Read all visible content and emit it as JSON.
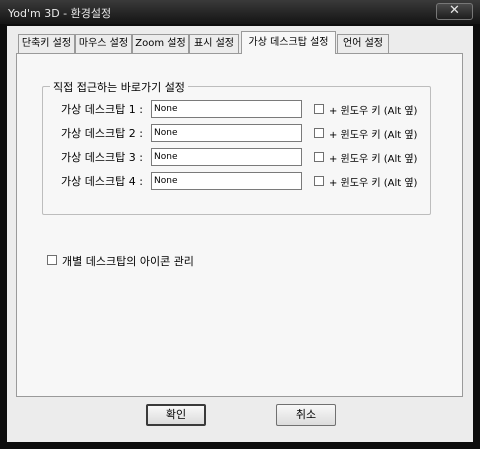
{
  "window": {
    "title": "Yod'm 3D - 환경설정",
    "close_glyph": "✕"
  },
  "tabs": [
    {
      "label": "단축키 설정"
    },
    {
      "label": "마우스 설정"
    },
    {
      "label": "Zoom 설정"
    },
    {
      "label": "표시 설정"
    },
    {
      "label": "가상 데스크탑 설정",
      "active": true
    },
    {
      "label": "언어 설정"
    }
  ],
  "group": {
    "title": "직접 접근하는 바로가기 설정",
    "rows": [
      {
        "label": "가상 데스크탑 1 :",
        "value": "None",
        "check_label": "+ 윈도우 키 (Alt 옆)",
        "checked": false
      },
      {
        "label": "가상 데스크탑 2 :",
        "value": "None",
        "check_label": "+ 윈도우 키 (Alt 옆)",
        "checked": false
      },
      {
        "label": "가상 데스크탑 3 :",
        "value": "None",
        "check_label": "+ 윈도우 키 (Alt 옆)",
        "checked": false
      },
      {
        "label": "가상 데스크탑 4 :",
        "value": "None",
        "check_label": "+ 윈도우 키 (Alt 옆)",
        "checked": false
      }
    ]
  },
  "icon_manage": {
    "label": "개별 데스크탑의 아이콘 관리",
    "checked": false
  },
  "buttons": {
    "ok": "확인",
    "cancel": "취소"
  }
}
